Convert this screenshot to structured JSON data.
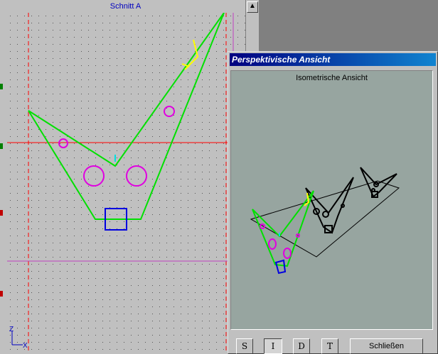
{
  "schnitt_window": {
    "title": "Schnitt A",
    "scroll_up_glyph": "▲",
    "axis_z": "Z",
    "axis_x": "X"
  },
  "persp_dialog": {
    "title": "Perspektivische Ansicht",
    "view_label": "Isometrische Ansicht",
    "buttons": [
      {
        "label": "S",
        "pressed": false
      },
      {
        "label": "I",
        "pressed": true
      },
      {
        "label": "D",
        "pressed": false
      },
      {
        "label": "T",
        "pressed": false
      }
    ],
    "close_label": "Schließen"
  },
  "colors": {
    "outline": "#00e000",
    "holes": "#e000e0",
    "rect": "#0000e0",
    "cut_line_red": "#ff0000",
    "guide_magenta": "#c040c0",
    "yellow_mark": "#ffff00",
    "cyan_mark": "#00e0e0"
  }
}
